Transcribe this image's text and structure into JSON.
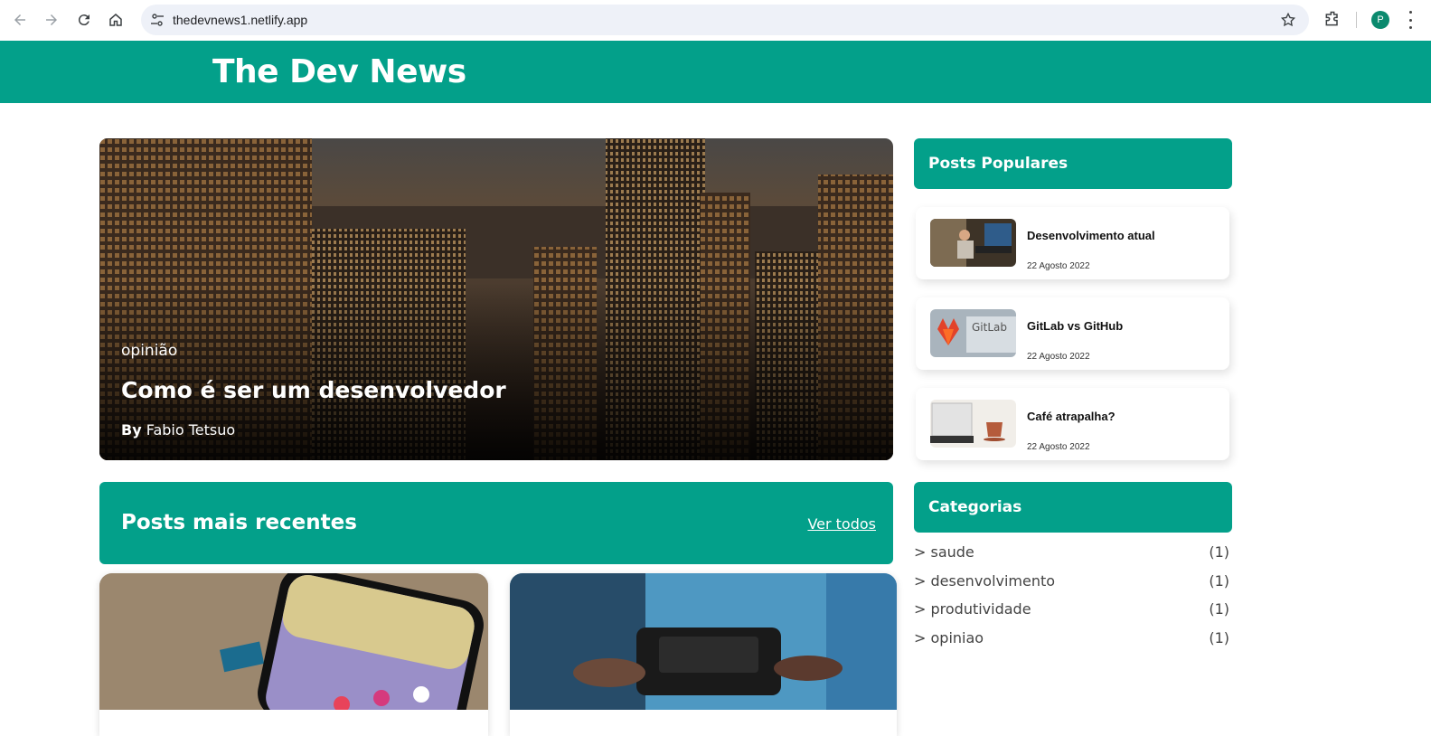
{
  "browser": {
    "url": "thedevnews1.netlify.app",
    "profile_initial": "P",
    "icons": [
      "back-icon",
      "forward-icon",
      "reload-icon",
      "home-icon",
      "site-settings-icon",
      "bookmark-star-icon",
      "extensions-icon",
      "menu-icon"
    ]
  },
  "site": {
    "title": "The Dev News",
    "brand_color": "#03a08a"
  },
  "hero": {
    "category": "opinião",
    "title": "Como é ser um desenvolvedor",
    "by_label": "By",
    "author": "Fabio Tetsuo"
  },
  "recent": {
    "heading": "Posts mais recentes",
    "see_all": "Ver todos"
  },
  "sidebar": {
    "popular_heading": "Posts Populares",
    "popular": [
      {
        "title": "Desenvolvimento atual",
        "date": "22 Agosto 2022"
      },
      {
        "title": "GitLab vs GitHub",
        "date": "22 Agosto 2022"
      },
      {
        "title": "Café atrapalha?",
        "date": "22 Agosto 2022"
      }
    ],
    "categories_heading": "Categorias",
    "categories": [
      {
        "name": "> saude",
        "count": "(1)"
      },
      {
        "name": "> desenvolvimento",
        "count": "(1)"
      },
      {
        "name": "> produtividade",
        "count": "(1)"
      },
      {
        "name": "> opiniao",
        "count": "(1)"
      }
    ]
  }
}
